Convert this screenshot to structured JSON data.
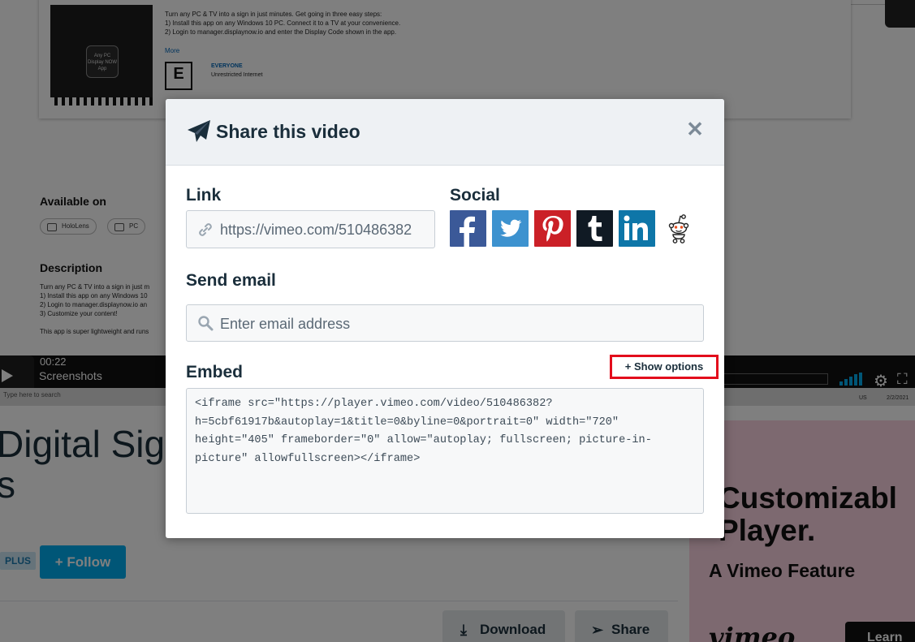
{
  "background": {
    "store": {
      "description_lines": "Turn any PC & TV into a sign in just minutes. Get going in three easy steps:\n1) Install this app on any Windows 10 PC. Connect it to a TV at your convenience.\n2) Login to manager.displaynow.io and enter the Display Code shown in the app.",
      "more_link": "More",
      "thumb_text": "Any PC\nDisplay NOW\nApp",
      "esrb_rating": "E",
      "esrb_title": "EVERYONE",
      "esrb_subtitle": "Unrestricted Internet",
      "available_on_title": "Available on",
      "platforms": [
        "HoloLens",
        "PC"
      ],
      "description_title": "Description",
      "description_text": "Turn any PC & TV into a sign in just m\n1) Install this app on any Windows 10\n2) Login to manager.displaynow.io an\n3) Customize your content!\n\nThis app is super lightweight and runs"
    },
    "player": {
      "time": "00:22",
      "caption": "Screenshots",
      "taskbar_search": "Type here to search",
      "taskbar_lang": "US",
      "taskbar_date": "2/2/2021"
    },
    "video_title": "Digital Sig\ns",
    "plus_badge": "PLUS",
    "follow_label": "+ Follow",
    "download_label": "Download",
    "share_label": "Share",
    "ad": {
      "title": "Customizabl\nPlayer.",
      "subtitle": "A Vimeo Feature",
      "logo": "vimeo",
      "cta": "Learn"
    }
  },
  "modal": {
    "title": "Share this video",
    "close_icon": "close-icon",
    "link": {
      "label": "Link",
      "value": "https://vimeo.com/510486382"
    },
    "social": {
      "label": "Social",
      "networks": [
        {
          "name": "Facebook",
          "icon": "facebook-icon",
          "color": "#3b5998"
        },
        {
          "name": "Twitter",
          "icon": "twitter-icon",
          "color": "#3d92cf"
        },
        {
          "name": "Pinterest",
          "icon": "pinterest-icon",
          "color": "#cb2027"
        },
        {
          "name": "Tumblr",
          "icon": "tumblr-icon",
          "color": "#101a24"
        },
        {
          "name": "LinkedIn",
          "icon": "linkedin-icon",
          "color": "#0e76a8"
        },
        {
          "name": "Reddit",
          "icon": "reddit-icon",
          "color": "#ffffff"
        }
      ]
    },
    "email": {
      "label": "Send email",
      "placeholder": "Enter email address",
      "value": ""
    },
    "embed": {
      "label": "Embed",
      "show_options": "+ Show options",
      "code": "<iframe src=\"https://player.vimeo.com/video/510486382?h=5cbf61917b&autoplay=1&title=0&byline=0&portrait=0\" width=\"720\" height=\"405\" frameborder=\"0\" allow=\"autoplay; fullscreen; picture-in-picture\" allowfullscreen></iframe>"
    },
    "highlight_color": "#e30d1c"
  }
}
